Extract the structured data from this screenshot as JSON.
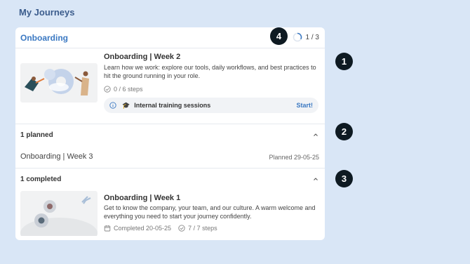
{
  "page": {
    "title": "My Journeys"
  },
  "journey": {
    "title": "Onboarding",
    "progress_text": "1 / 3",
    "progress_fraction": 0.333
  },
  "current": {
    "title": "Onboarding | Week 2",
    "description": "Learn how we work: explore our tools, daily workflows, and best practices to hit the ground running in your role.",
    "steps": "0 / 6 steps",
    "training_label": "Internal training sessions",
    "training_action": "Start!",
    "info_icon": "info-icon",
    "cap_icon": "graduation-cap-icon"
  },
  "planned": {
    "header": "1 planned",
    "item_name": "Onboarding | Week 3",
    "item_date": "Planned 29-05-25"
  },
  "completed": {
    "header": "1 completed",
    "title": "Onboarding | Week 1",
    "description": "Get to know the company, your team, and our culture. A warm welcome and everything you need to start your journey confidently.",
    "completed_date": "Completed 20-05-25",
    "steps": "7 / 7 steps"
  },
  "badges": {
    "b1": "1",
    "b2": "2",
    "b3": "3",
    "b4": "4"
  },
  "colors": {
    "accent": "#3a78c2",
    "background": "#d9e6f6",
    "badge": "#0e1a22"
  }
}
